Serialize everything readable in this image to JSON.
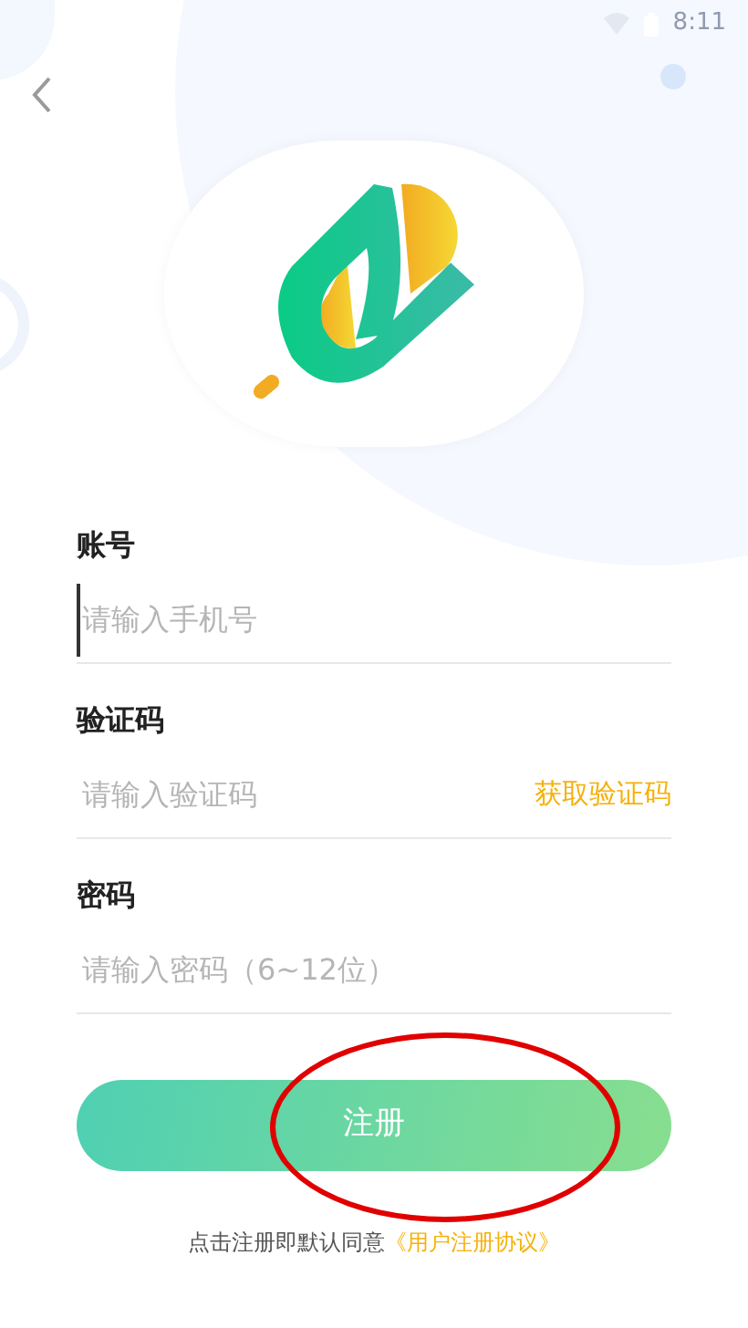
{
  "status_bar": {
    "time": "8:11"
  },
  "fields": [
    {
      "label": "账号",
      "placeholder": "请输入手机号",
      "focused": true
    },
    {
      "label": "验证码",
      "placeholder": "请输入验证码",
      "focused": false,
      "action": "获取验证码"
    },
    {
      "label": "密码",
      "placeholder": "请输入密码（6~12位）",
      "focused": false
    }
  ],
  "submit_button": {
    "label": "注册"
  },
  "agreement": {
    "text": "点击注册即默认同意",
    "link": "《用户注册协议》"
  }
}
